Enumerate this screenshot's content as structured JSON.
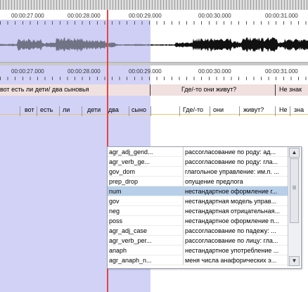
{
  "ruler_top": [
    "00:00:27.000",
    "00:00:28.000",
    "00:00:29.000",
    "00:00:30.000",
    "00:00:31.000"
  ],
  "ruler_mid": [
    "00:00:27.000",
    "00:00:28.000",
    "00:00:29.000",
    "00:00:30.000",
    "00:00:31.000"
  ],
  "tier1": {
    "seg1": "вот есть ли дети/ два сыновья",
    "seg2": "Где/-то они живут?",
    "seg3": "Не знак"
  },
  "tier2": [
    "вот",
    "есть",
    "ли",
    "дети",
    "два",
    "сыно",
    "Где/-то",
    "они",
    "живут?",
    "Не",
    "зна"
  ],
  "colors": {
    "selection": "#cfcff6",
    "cursor": "#e34646",
    "selected_row": "#b7cfe8"
  },
  "dropdown": {
    "rows": [
      {
        "tag": "agr_adj_gend...",
        "desc": "рассогласование по роду: ад..."
      },
      {
        "tag": "agr_verb_ge...",
        "desc": "рассогласование по роду: гла..."
      },
      {
        "tag": "gov_dom",
        "desc": "глагольное управление: им.п. ..."
      },
      {
        "tag": "prep_drop",
        "desc": "опущение предлога"
      },
      {
        "tag": "num",
        "desc": "нестандартное оформление г..."
      },
      {
        "tag": "gov",
        "desc": "нестандартная модель управ..."
      },
      {
        "tag": "neg",
        "desc": "нестандартная отрицательная..."
      },
      {
        "tag": "poss",
        "desc": "нестандартное оформление п..."
      },
      {
        "tag": "agr_adj_case",
        "desc": "рассогласование по падежу: ..."
      },
      {
        "tag": "agr_verb_per...",
        "desc": "рассогласование по лицу: гла..."
      },
      {
        "tag": "anaph",
        "desc": "нестандартное употребление ..."
      },
      {
        "tag": "agr_anaph_n...",
        "desc": "меня числа анафорических э..."
      }
    ],
    "selected_index": 4,
    "scroll_up": "▲",
    "scroll_down": "▼"
  }
}
